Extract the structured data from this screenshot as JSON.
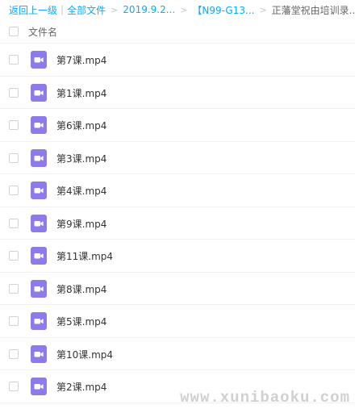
{
  "breadcrumb": {
    "back": "返回上一级",
    "all_files": "全部文件",
    "crumb_1": "2019.9.2...",
    "crumb_2": "【N99-G13...",
    "current": "正藩堂祝由培训录...",
    "separator": "|",
    "arrow": ">"
  },
  "list_header": {
    "name_column": "文件名"
  },
  "files": [
    {
      "name": "第7课.mp4"
    },
    {
      "name": "第1课.mp4"
    },
    {
      "name": "第6课.mp4"
    },
    {
      "name": "第3课.mp4"
    },
    {
      "name": "第4课.mp4"
    },
    {
      "name": "第9课.mp4"
    },
    {
      "name": "第11课.mp4"
    },
    {
      "name": "第8课.mp4"
    },
    {
      "name": "第5课.mp4"
    },
    {
      "name": "第10课.mp4"
    },
    {
      "name": "第2课.mp4"
    }
  ],
  "watermark": "www.xunibaoku.com",
  "colors": {
    "link": "#09aaff",
    "video_icon": "#8c7be8",
    "text": "#333333"
  }
}
